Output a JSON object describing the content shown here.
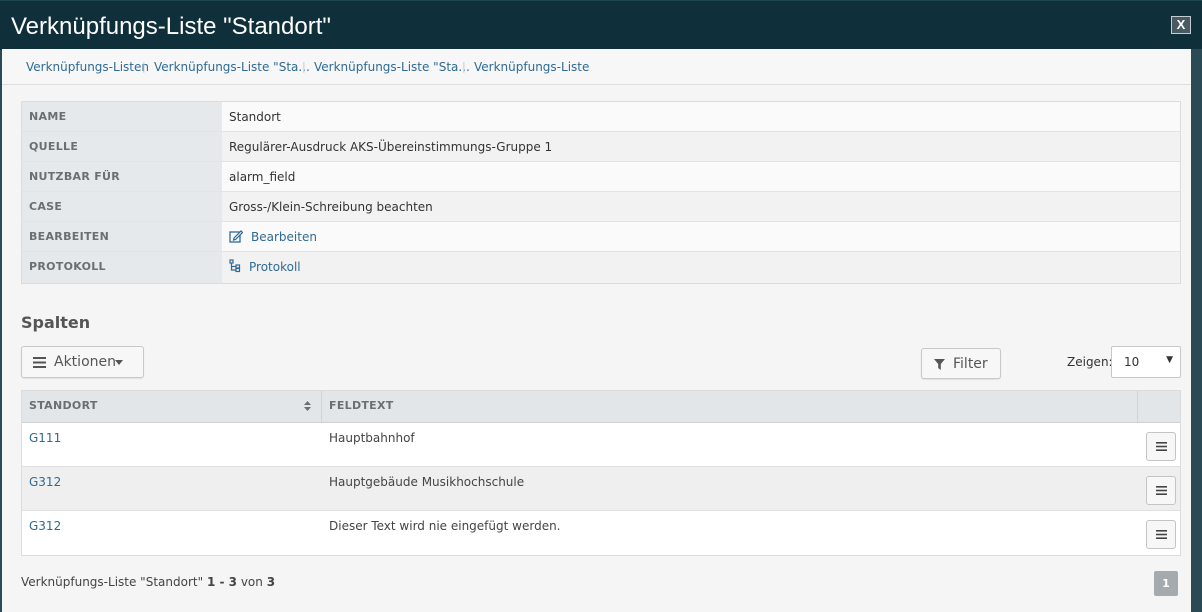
{
  "modal": {
    "title": "Verknüpfungs-Liste \"Standort\"",
    "close_label": "X"
  },
  "breadcrumb": [
    {
      "label": "Verknüpfungs-Listen"
    },
    {
      "label": "Verknüpfungs-Liste \"Sta..."
    },
    {
      "label": "Verknüpfungs-Liste \"Sta..."
    },
    {
      "label": "Verknüpfungs-Liste"
    }
  ],
  "details": {
    "name_label": "NAME",
    "name_value": "Standort",
    "quelle_label": "QUELLE",
    "quelle_value": "Regulärer-Ausdruck AKS-Übereinstimmungs-Gruppe 1",
    "nutzbar_label": "NUTZBAR FÜR",
    "nutzbar_value": "alarm_field",
    "case_label": "CASE",
    "case_value": "Gross-/Klein-Schreibung beachten",
    "bearbeiten_label": "BEARBEITEN",
    "bearbeiten_link": "Bearbeiten",
    "protokoll_label": "PROTOKOLL",
    "protokoll_link": "Protokoll"
  },
  "section": {
    "title": "Spalten"
  },
  "toolbar": {
    "aktionen_label": "Aktionen",
    "filter_label": "Filter",
    "show_label": "Zeigen:",
    "show_value": "10"
  },
  "table": {
    "headers": {
      "standort": "STANDORT",
      "feldtext": "FELDTEXT"
    },
    "rows": [
      {
        "standort": "G111",
        "feldtext": "Hauptbahnhof"
      },
      {
        "standort": "G312",
        "feldtext": "Hauptgebäude Musikhochschule"
      },
      {
        "standort": "G312",
        "feldtext": "Dieser Text wird nie eingefügt werden."
      }
    ]
  },
  "footer": {
    "info_prefix": "Verknüpfungs-Liste \"Standort\"",
    "info_range": "1 - 3",
    "info_von": "von",
    "info_total": "3",
    "page": "1"
  },
  "colors": {
    "header_bg": "#0f2f3a",
    "link": "#2f6a95",
    "label_bg": "#e5e9ec"
  }
}
